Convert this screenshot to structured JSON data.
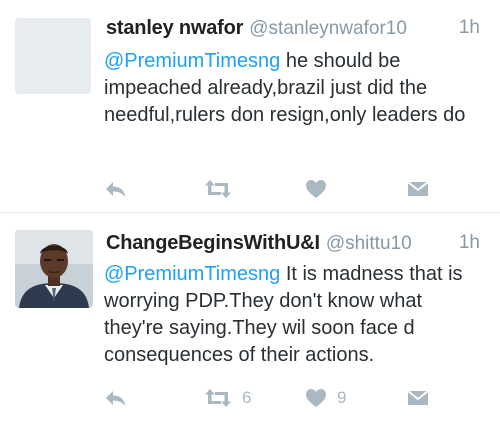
{
  "colors": {
    "link": "#1da1f2",
    "muted": "#8899a6",
    "icon": "#aab8c2",
    "divider": "#e1e8ed"
  },
  "tweets": [
    {
      "name": "stanley nwafor",
      "handle": "@stanleynwafor10",
      "time": "1h",
      "mention": "@PremiumTimesng",
      "text": " he should be impeached already,brazil just did the needful,rulers don resign,only leaders do",
      "retweets": "",
      "likes": "",
      "icons": [
        "reply-icon",
        "retweet-icon",
        "heart-icon",
        "direct-message-icon"
      ]
    },
    {
      "name": "ChangeBeginsWithU&I",
      "handle": "@shittu10",
      "time": "1h",
      "mention": "@PremiumTimesng",
      "text": " It is madness that is worrying PDP.They don't know what they're saying.They wil soon face d consequences of their actions.",
      "retweets": "6",
      "likes": "9",
      "icons": [
        "reply-icon",
        "retweet-icon",
        "heart-icon",
        "direct-message-icon"
      ]
    }
  ]
}
